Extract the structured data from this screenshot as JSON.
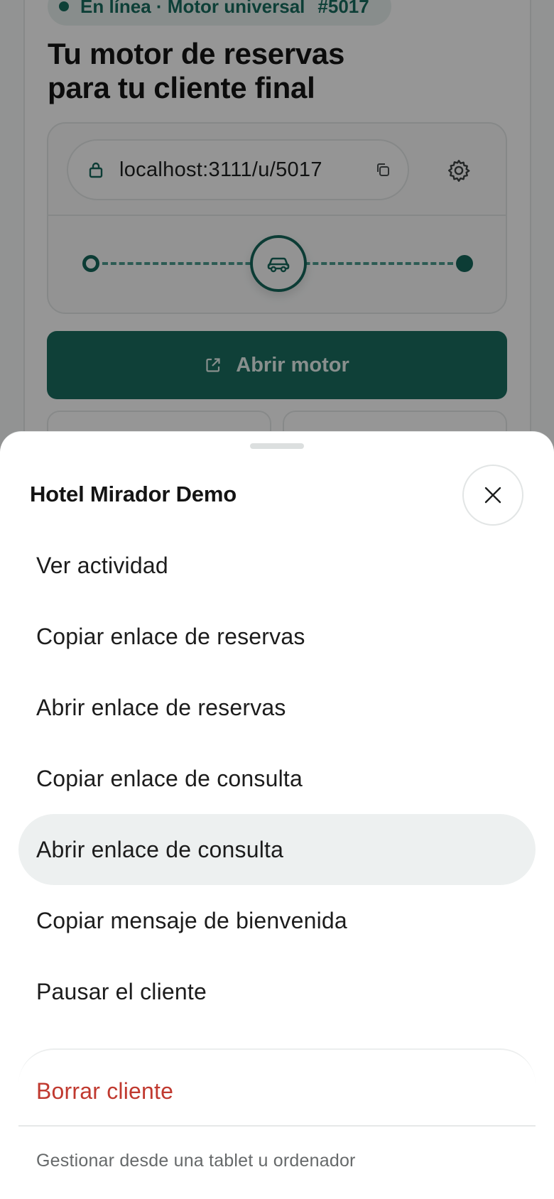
{
  "background": {
    "status": {
      "text": "En línea · Motor universal",
      "id": "#5017"
    },
    "hero_title_line1": "Tu motor de reservas",
    "hero_title_line2": "para tu cliente final",
    "url": "localhost:3111/u/5017",
    "open_button_label": "Abrir motor",
    "icons": [
      "lock-icon",
      "copy-icon",
      "gear-icon",
      "car-icon",
      "external-link-icon"
    ],
    "accent_color": "#1a6b5e"
  },
  "sheet": {
    "title": "Hotel Mirador Demo",
    "close_icon": "close-icon",
    "menu_items": [
      {
        "label": "Ver actividad"
      },
      {
        "label": "Copiar enlace de reservas"
      },
      {
        "label": "Abrir enlace de reservas"
      },
      {
        "label": "Copiar enlace de consulta"
      },
      {
        "label": "Abrir enlace de consulta",
        "highlighted": true
      },
      {
        "label": "Copiar mensaje de bienvenida"
      },
      {
        "label": "Pausar el cliente"
      }
    ],
    "danger_item": "Borrar cliente",
    "danger_color": "#c0392f",
    "footer_note": "Gestionar desde una tablet u ordenador"
  }
}
